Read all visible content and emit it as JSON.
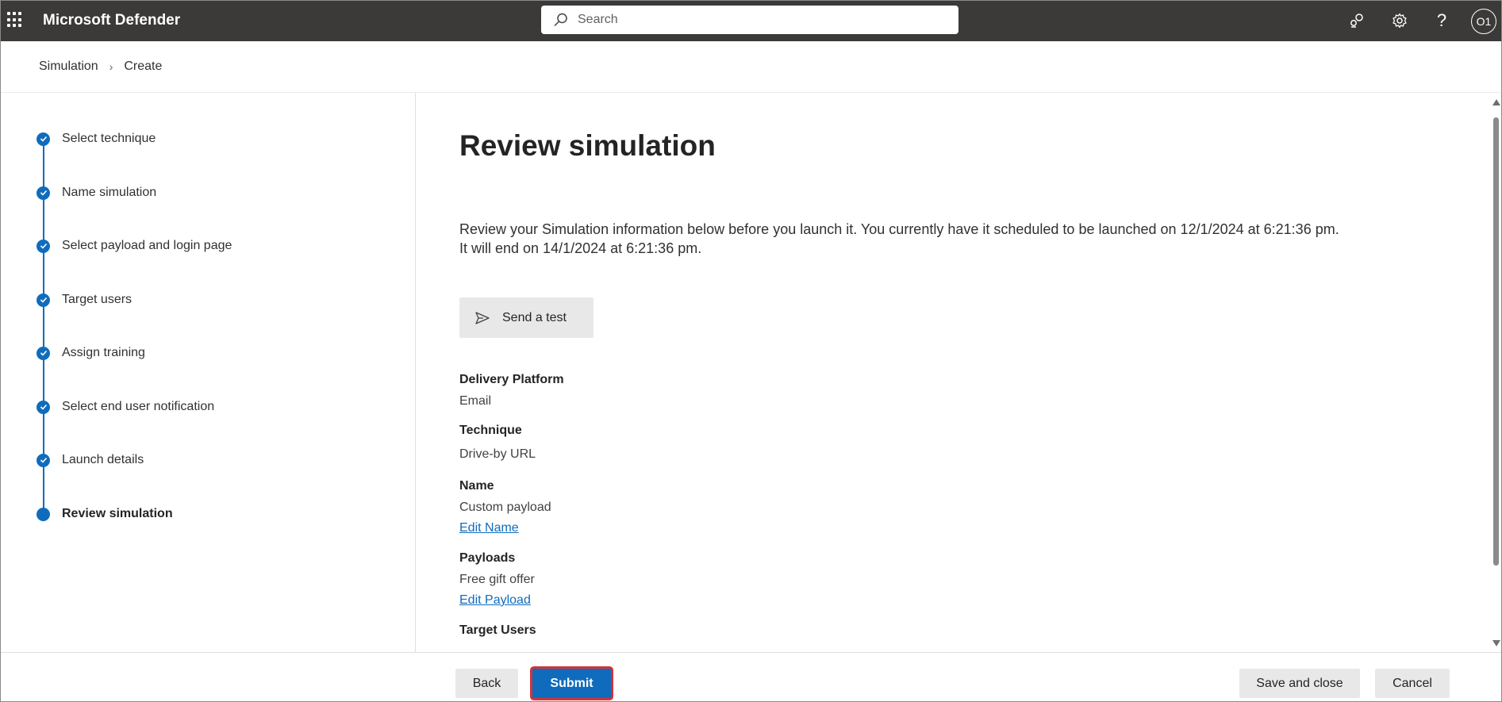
{
  "app": {
    "title": "Microsoft Defender"
  },
  "search": {
    "placeholder": "Search"
  },
  "header_icons": [
    "share-icon",
    "gear-icon",
    "help-icon"
  ],
  "user": {
    "initials": "O1"
  },
  "breadcrumb": {
    "items": [
      "Simulation",
      "Create"
    ]
  },
  "steps": [
    {
      "label": "Select technique",
      "status": "complete"
    },
    {
      "label": "Name simulation",
      "status": "complete"
    },
    {
      "label": "Select payload and login page",
      "status": "complete"
    },
    {
      "label": "Target users",
      "status": "complete"
    },
    {
      "label": "Assign training",
      "status": "complete"
    },
    {
      "label": "Select end user notification",
      "status": "complete"
    },
    {
      "label": "Launch details",
      "status": "complete"
    },
    {
      "label": "Review simulation",
      "status": "current"
    }
  ],
  "main": {
    "title": "Review simulation",
    "intro_line1": "Review your Simulation information below before you launch it. You currently have it scheduled to be launched on 12/1/2024 at 6:21:36 pm.",
    "intro_line2": "It will end on 14/1/2024 at 6:21:36 pm.",
    "send_test_label": "Send a test",
    "fields": {
      "delivery_platform": {
        "label": "Delivery Platform",
        "value": "Email"
      },
      "technique": {
        "label": "Technique",
        "value": "Drive-by URL"
      },
      "name": {
        "label": "Name",
        "value": "Custom payload",
        "edit": "Edit Name"
      },
      "payloads": {
        "label": "Payloads",
        "value": "Free gift offer",
        "edit": "Edit Payload"
      },
      "target_users": {
        "label": "Target Users"
      }
    }
  },
  "footer": {
    "back": "Back",
    "submit": "Submit",
    "save_close": "Save and close",
    "cancel": "Cancel"
  },
  "colors": {
    "accent": "#0f6cbd",
    "topbar": "#3b3a39",
    "highlight": "#d13438"
  }
}
